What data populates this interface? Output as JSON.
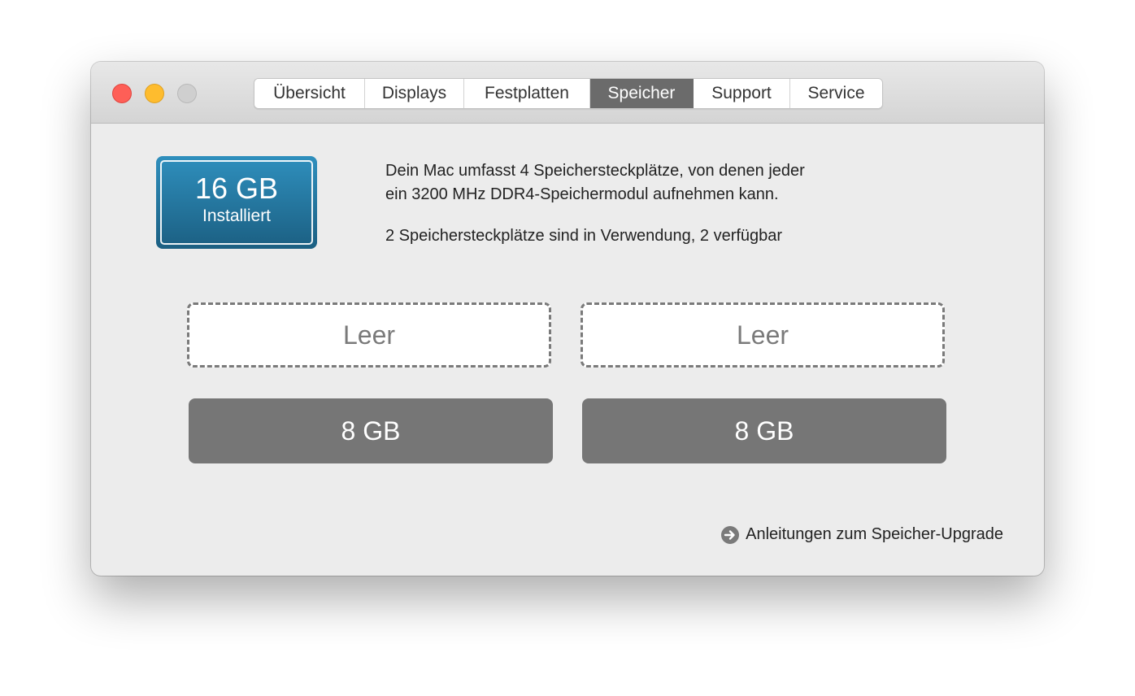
{
  "tabs": [
    {
      "label": "Übersicht"
    },
    {
      "label": "Displays"
    },
    {
      "label": "Festplatten"
    },
    {
      "label": "Speicher",
      "active": true
    },
    {
      "label": "Support"
    },
    {
      "label": "Service"
    }
  ],
  "installed": {
    "size": "16 GB",
    "label": "Installiert",
    "color": "#2a84b3"
  },
  "info": {
    "line1": "Dein Mac umfasst 4 Speichersteckplätze, von denen jeder",
    "line2": "ein 3200 MHz DDR4-Speichermodul aufnehmen kann.",
    "usage": "2 Speichersteckplätze sind in Verwendung, 2 verfügbar"
  },
  "slots": [
    {
      "label": "Leer",
      "state": "empty"
    },
    {
      "label": "Leer",
      "state": "empty"
    },
    {
      "label": "8 GB",
      "state": "filled"
    },
    {
      "label": "8 GB",
      "state": "filled"
    }
  ],
  "upgrade_link": {
    "label": "Anleitungen zum Speicher-Upgrade",
    "icon": "arrow-right-circle-icon"
  },
  "traffic_lights": {
    "close": "#fe5f57",
    "minimize": "#febc2e",
    "zoom": "#cfcfcf"
  }
}
